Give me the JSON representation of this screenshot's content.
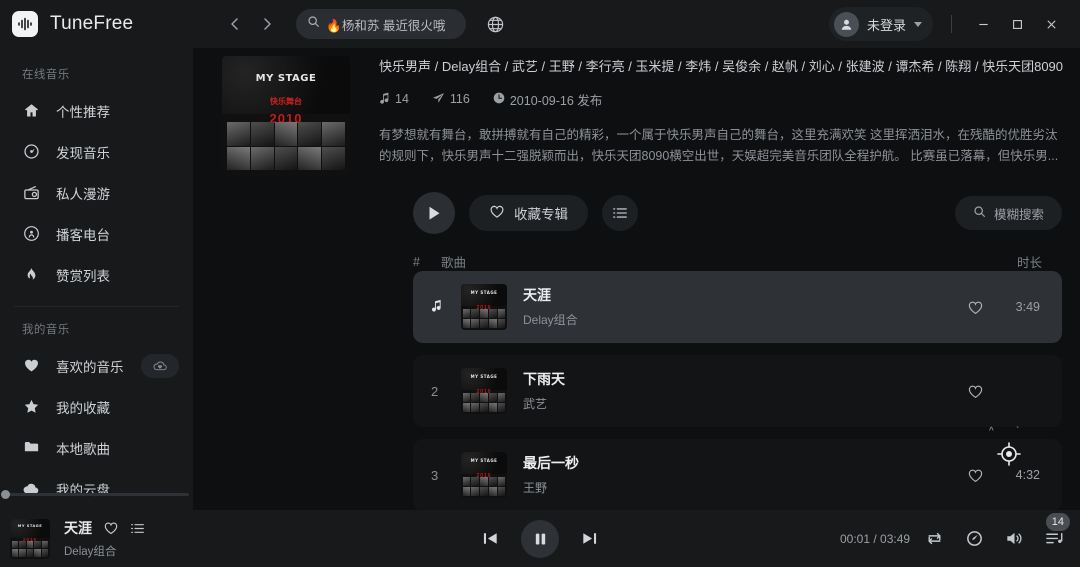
{
  "app": {
    "name": "TuneFree",
    "logo_icon": "waveform-icon"
  },
  "titlebar": {
    "back_icon": "chevron-left-icon",
    "forward_icon": "chevron-right-icon",
    "search": {
      "icon": "search-icon",
      "placeholder": "🔥杨和苏 最近很火哦",
      "value": ""
    },
    "globe_icon": "globe-icon",
    "account": {
      "label": "未登录",
      "avatar_icon": "user-avatar-icon",
      "caret_icon": "chevron-down-icon"
    },
    "window": {
      "minimize": "minimize-icon",
      "maximize": "maximize-icon",
      "close": "close-icon"
    }
  },
  "sidebar": {
    "groups": [
      {
        "title": "在线音乐",
        "items": [
          {
            "label": "个性推荐",
            "icon": "home-icon"
          },
          {
            "label": "发现音乐",
            "icon": "disc-icon"
          },
          {
            "label": "私人漫游",
            "icon": "radio-icon"
          },
          {
            "label": "播客电台",
            "icon": "podcast-icon"
          },
          {
            "label": "赞赏列表",
            "icon": "flame-icon"
          }
        ]
      },
      {
        "title": "我的音乐",
        "items": [
          {
            "label": "喜欢的音乐",
            "icon": "heart-filled-icon",
            "badge_icon": "cloud-heart-icon"
          },
          {
            "label": "我的收藏",
            "icon": "star-icon"
          },
          {
            "label": "本地歌曲",
            "icon": "folder-icon"
          },
          {
            "label": "我的云盘",
            "icon": "cloud-icon"
          }
        ]
      }
    ]
  },
  "album": {
    "cover": {
      "title": "MY STAGE",
      "subtitle": "快乐舞台",
      "big": "2010",
      "photo_count": 10
    },
    "artists": "快乐男声 / Delay组合 / 武艺 / 王野 / 李行亮 / 玉米提 / 李炜 / 吴俊余 / 赵帆 / 刘心 / 张建波 / 谭杰希 / 陈翔 / 快乐天团8090",
    "meta": {
      "songs_icon": "music-note-icon",
      "songs_count": "14",
      "share_icon": "share-icon",
      "share_count": "116",
      "date_icon": "clock-icon",
      "date": "2010-09-16 发布"
    },
    "description": "有梦想就有舞台，敢拼搏就有自己的精彩，一个属于快乐男声自己的舞台，这里充满欢笑 这里挥洒泪水，在残酷的优胜劣汰的规则下，快乐男声十二强脱颖而出，快乐天团8090横空出世，天娱超完美音乐团队全程护航。 比赛虽已落幕，但快乐男..."
  },
  "actions": {
    "play_icon": "play-icon",
    "collect": {
      "label": "收藏专辑",
      "icon": "heart-outline-icon"
    },
    "list_icon": "list-icon",
    "fuzzy_search": {
      "label": "模糊搜索",
      "icon": "search-icon"
    }
  },
  "tracklist": {
    "columns": {
      "index": "#",
      "song": "歌曲",
      "duration": "时长"
    },
    "rows": [
      {
        "index": "",
        "index_icon": "music-note-icon",
        "title": "天涯",
        "artist": "Delay组合",
        "duration": "3:49",
        "heart_icon": "heart-outline-icon",
        "active": true
      },
      {
        "index": "2",
        "title": "下雨天",
        "artist": "武艺",
        "duration": "",
        "heart_icon": "heart-outline-icon",
        "active": false
      },
      {
        "index": "3",
        "title": "最后一秒",
        "artist": "王野",
        "duration": "4:32",
        "heart_icon": "heart-outline-icon",
        "active": false
      }
    ]
  },
  "player": {
    "now_playing": {
      "title": "天涯",
      "artist": "Delay组合",
      "heart_icon": "heart-outline-icon",
      "lyrics_icon": "list-icon"
    },
    "controls": {
      "prev_icon": "previous-icon",
      "pause_icon": "pause-icon",
      "next_icon": "next-icon"
    },
    "time": "00:01 / 03:49",
    "right_icons": {
      "repeat": "repeat-icon",
      "speed": "gauge-icon",
      "volume": "volume-icon",
      "queue": "playlist-icon"
    },
    "queue_badge": "14"
  },
  "cursor": {
    "icon": "crosshair-icon"
  },
  "colors": {
    "bg_main": "#0e0f11",
    "bg_panel": "#17191b",
    "row_active": "#2e3135",
    "text": "#d6d8da",
    "accent_red": "#c41a1a"
  }
}
